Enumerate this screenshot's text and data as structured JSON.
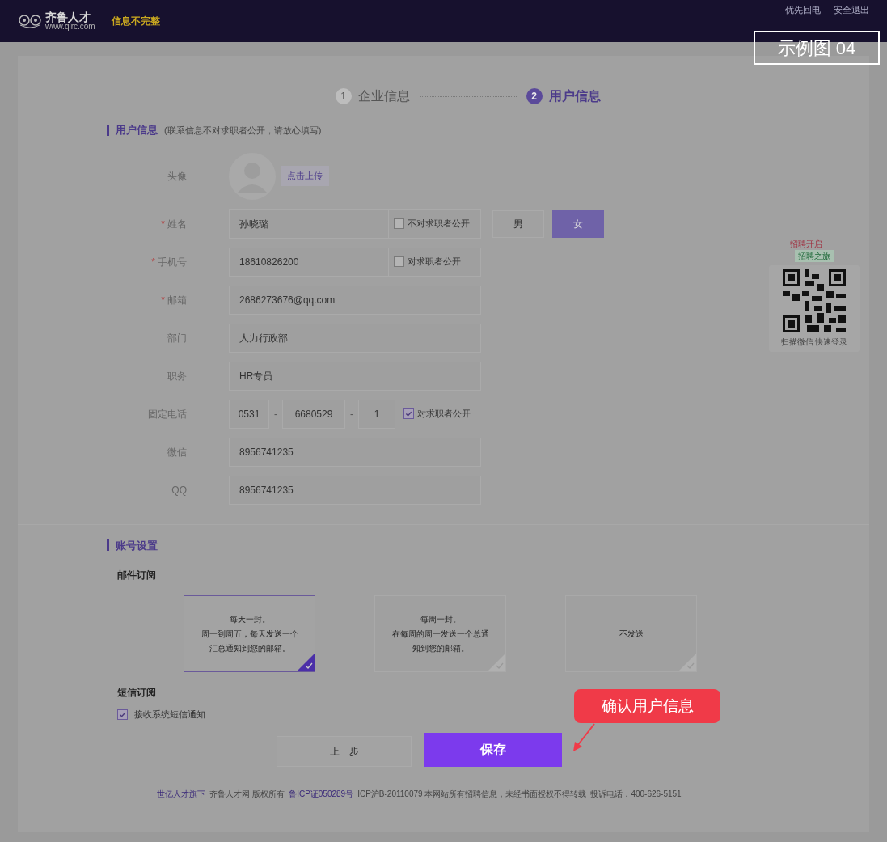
{
  "header": {
    "logo_text": "齐鲁人才",
    "logo_url": "www.qlrc.com",
    "status": "信息不完整",
    "links": [
      "优先回电",
      "安全退出"
    ]
  },
  "example_label": "示例图 04",
  "steps": [
    {
      "number": "1",
      "label": "企业信息",
      "selected": false
    },
    {
      "number": "2",
      "label": "用户信息",
      "selected": true
    }
  ],
  "user_section": {
    "title": "用户信息",
    "note": "(联系信息不对求职者公开，请放心填写)"
  },
  "avatar": {
    "label": "头像",
    "upload": "点击上传"
  },
  "fields": [
    {
      "kind": "name",
      "label": "姓名",
      "mark": "*",
      "value": "孙晓璐",
      "privacy": {
        "label": "不对求职者公开",
        "checked": false
      },
      "genders": [
        {
          "label": "男",
          "selected": false
        },
        {
          "label": "女",
          "selected": true
        }
      ]
    },
    {
      "kind": "text",
      "label": "手机号",
      "mark": "*",
      "value": "18610826200",
      "privacy": {
        "label": "对求职者公开",
        "checked": false
      }
    },
    {
      "kind": "text",
      "label": "邮箱",
      "mark": "*",
      "value": "2686273676@qq.com"
    },
    {
      "kind": "text",
      "label": "部门",
      "value": "人力行政部"
    },
    {
      "kind": "text",
      "label": "职务",
      "value": "HR专员"
    },
    {
      "kind": "phone",
      "label": "固定电话",
      "parts": [
        "0531",
        "6680529",
        "1"
      ],
      "separators": [
        "-",
        "-"
      ],
      "privacy": {
        "label": "对求职者公开",
        "checked": true
      }
    },
    {
      "kind": "text",
      "label": "微信",
      "value": "8956741235"
    },
    {
      "kind": "text",
      "label": "QQ",
      "value": "8956741235"
    }
  ],
  "account_section": {
    "title": "账号设置"
  },
  "mail": {
    "title": "邮件订阅",
    "options": [
      {
        "lines": [
          "每天一封。",
          "周一到周五，每天发送一个",
          "汇总通知到您的邮箱。"
        ],
        "selected": true
      },
      {
        "lines": [
          "每周一封。",
          "在每周的周一发送一个总通",
          "知到您的邮箱。"
        ],
        "selected": false
      },
      {
        "lines": [
          "不发送"
        ],
        "selected": false
      }
    ]
  },
  "sms": {
    "title": "短信订阅",
    "label": "接收系统短信通知",
    "checked": true
  },
  "buttons": {
    "back": "上一步",
    "save": "保存"
  },
  "callout": "确认用户信息",
  "qr": {
    "tag_top": "招聘开启",
    "tag_bottom": "招聘之旅",
    "caption": "扫描微信 快速登录"
  },
  "footer": {
    "parts": [
      {
        "text": "世亿人才旗下",
        "kind": "link"
      },
      {
        "text": "齐鲁人才网 版权所有",
        "kind": "text"
      },
      {
        "text": "鲁ICP证050289号",
        "kind": "link"
      },
      {
        "text": "ICP沪B-20110079 本网站所有招聘信息，未经书面授权不得转载",
        "kind": "text"
      },
      {
        "text": "投诉电话：400-626-5151",
        "kind": "text"
      }
    ]
  }
}
